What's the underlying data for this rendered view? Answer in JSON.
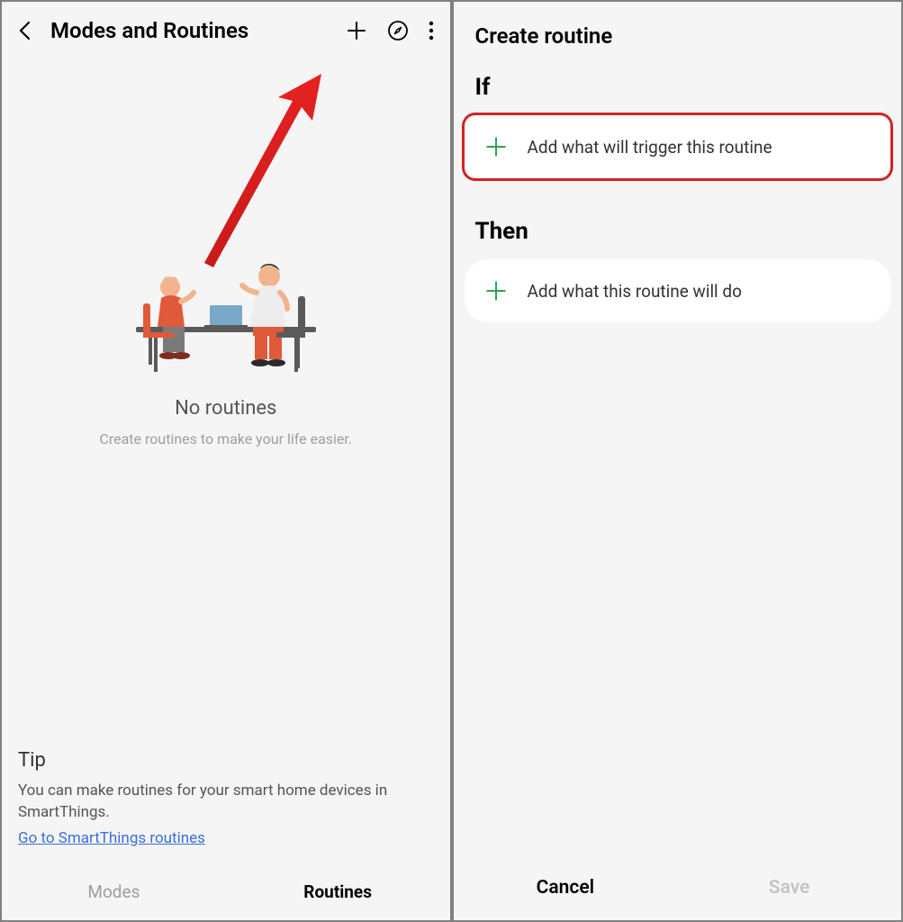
{
  "left": {
    "title": "Modes and Routines",
    "empty_title": "No routines",
    "empty_subtitle": "Create routines to make your life easier.",
    "tip": {
      "heading": "Tip",
      "body": "You can make routines for your smart home devices in SmartThings.",
      "link_label": "Go to SmartThings routines"
    },
    "tabs": {
      "modes": "Modes",
      "routines": "Routines"
    }
  },
  "right": {
    "title": "Create routine",
    "if_label": "If",
    "if_card": "Add what will trigger this routine",
    "then_label": "Then",
    "then_card": "Add what this routine will do",
    "cancel": "Cancel",
    "save": "Save"
  }
}
